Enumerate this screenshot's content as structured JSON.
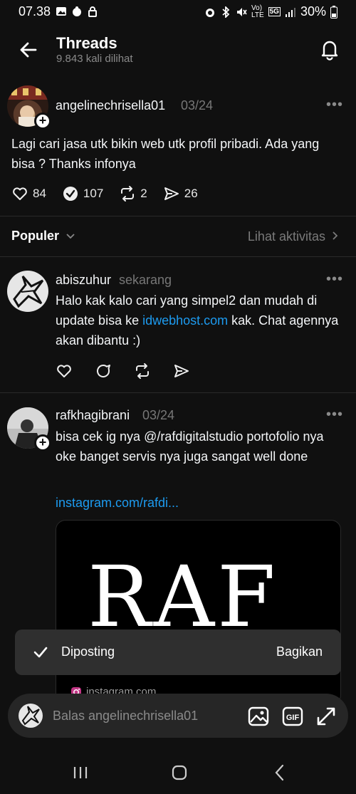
{
  "status_bar": {
    "time": "07.38",
    "network_label": "5G",
    "battery": "30%"
  },
  "header": {
    "title": "Threads",
    "views": "9.843 kali dilihat"
  },
  "main_post": {
    "username": "angelinechrisella01",
    "date": "03/24",
    "text": "Lagi cari jasa utk bikin web utk profil pribadi. Ada yang bisa ? Thanks infonya",
    "likes": "84",
    "replies": "107",
    "reposts": "2",
    "shares": "26"
  },
  "sort": {
    "label": "Populer",
    "activity": "Lihat aktivitas"
  },
  "replies": [
    {
      "username": "abiszuhur",
      "time": "sekarang",
      "text_before": "Halo kak kalo cari yang simpel2 dan mudah di update bisa ke ",
      "link": "idwebhost.com",
      "text_after": " kak. Chat agennya akan dibantu :)"
    },
    {
      "username": "rafkhagibrani",
      "time": "03/24",
      "text": "bisa cek ig nya @/rafdigitalstudio portofolio nya oke banget servis nya juga sangat well done",
      "link": "instagram.com/rafdi...",
      "media_text": "RAF",
      "media_source": "instagram.com"
    }
  ],
  "toast": {
    "message": "Diposting",
    "action": "Bagikan"
  },
  "reply_bar": {
    "placeholder": "Balas angelinechrisella01"
  },
  "colors": {
    "background": "#101010",
    "link": "#1d9bf0",
    "muted": "#777777"
  }
}
